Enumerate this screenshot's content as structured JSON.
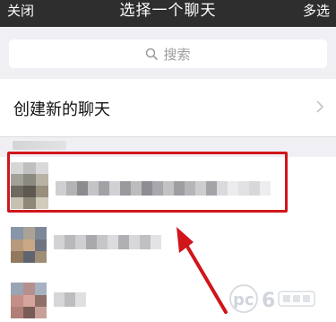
{
  "nav": {
    "close_label": "关闭",
    "title": "选择一个聊天",
    "multi_select_label": "多选"
  },
  "search": {
    "placeholder": "搜索"
  },
  "new_chat": {
    "label": "创建新的聊天"
  },
  "colors": {
    "nav_bg": "#2e2e2e",
    "highlight": "#d0161b",
    "arrow": "#d0161b"
  },
  "icons": [
    "search-icon",
    "chevron-right-icon"
  ]
}
